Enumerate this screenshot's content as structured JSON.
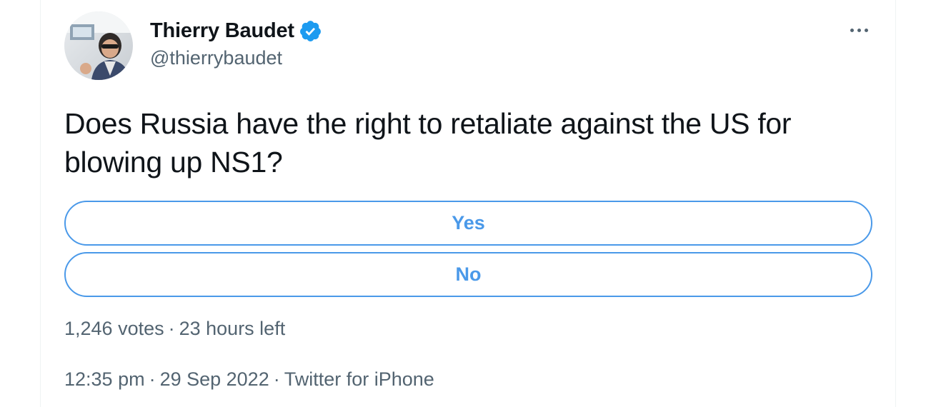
{
  "author": {
    "display_name": "Thierry Baudet",
    "handle": "@thierrybaudet",
    "verified": true,
    "avatar_icon": "avatar-photo"
  },
  "menu": {
    "icon": "more-horizontal-icon"
  },
  "tweet": {
    "text": "Does Russia have the right to retaliate against the US for blowing up NS1?"
  },
  "poll": {
    "options": [
      {
        "label": "Yes"
      },
      {
        "label": "No"
      }
    ],
    "votes": "1,246 votes",
    "separator": "·",
    "time_left": "23 hours left"
  },
  "meta": {
    "time": "12:35 pm",
    "separator": "·",
    "date": "29 Sep 2022",
    "source": "Twitter for iPhone"
  },
  "colors": {
    "accent": "#4a99e9",
    "verified": "#1d9bf0",
    "text": "#0f1419",
    "secondary": "#536471"
  }
}
